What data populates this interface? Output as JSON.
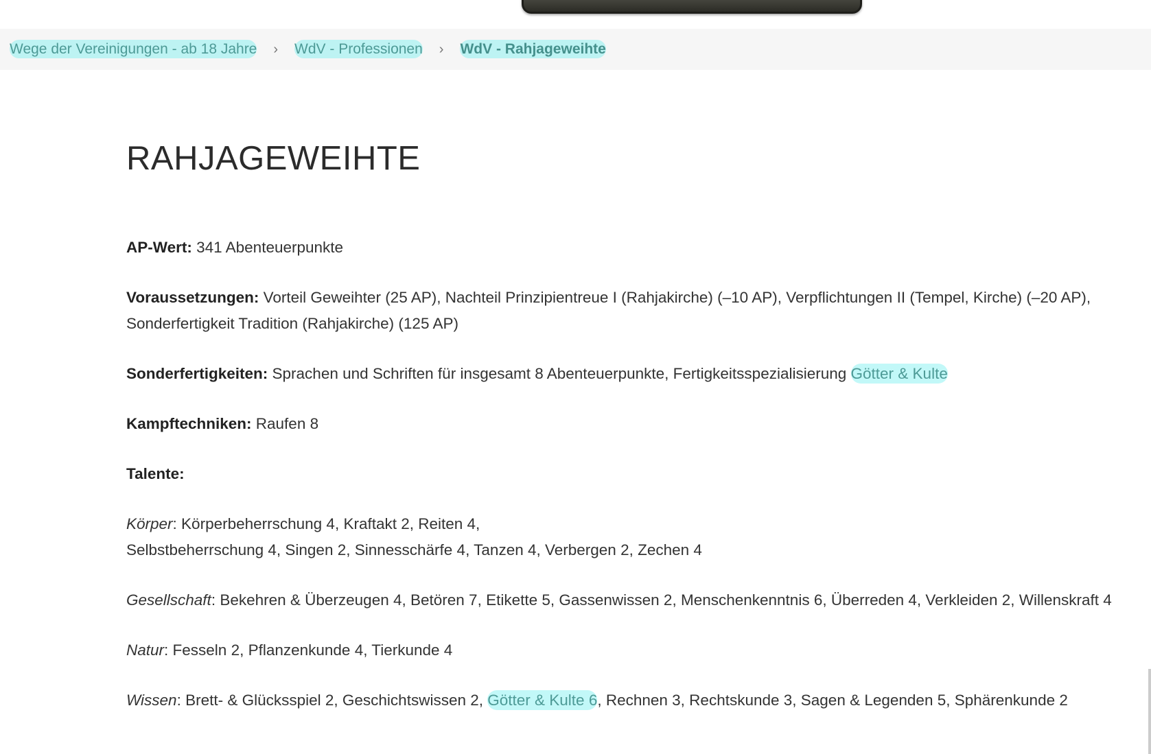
{
  "breadcrumb": {
    "items": [
      {
        "label": "Wege der Vereinigungen - ab 18 Jahre"
      },
      {
        "label": "WdV - Professionen"
      },
      {
        "label": "WdV - Rahjageweihte"
      }
    ],
    "separator": "›"
  },
  "article": {
    "title": "RAHJAGEWEIHTE",
    "ap": {
      "label": "AP-Wert:",
      "value": " 341 Abenteuerpunkte"
    },
    "voraussetzungen": {
      "label": "Voraussetzungen:",
      "value": " Vorteil Geweihter (25 AP), Nachteil Prinzipientreue I (Rahjakirche) (–10 AP), Verpflichtungen II (Tempel, Kirche) (–20 AP), Sonderfertigkeit Tradition (Rahjakirche) (125 AP)"
    },
    "sonderfertigkeiten": {
      "label": "Sonderfertigkeiten:",
      "value": " Sprachen und Schriften für insgesamt 8 Abenteuerpunkte, Fertigkeitsspezialisierung ",
      "link": "Götter & Kulte"
    },
    "kampftechniken": {
      "label": "Kampftechniken:",
      "value": " Raufen 8"
    },
    "talente": {
      "label": "Talente:"
    },
    "koerper": {
      "category": "Körper",
      "line1": ": Körperbeherrschung 4, Kraftakt 2, Reiten 4,",
      "line2": "Selbstbeherrschung 4, Singen 2, Sinnesschärfe 4, Tanzen 4, Verbergen 2, Zechen 4"
    },
    "gesellschaft": {
      "category": "Gesellschaft",
      "value": ": Bekehren & Überzeugen 4, Betören 7, Etikette 5, Gassenwissen 2, Menschenkenntnis 6, Überreden 4, Verkleiden 2, Willenskraft 4"
    },
    "natur": {
      "category": "Natur",
      "value": ": Fesseln 2, Pflanzenkunde 4, Tierkunde 4"
    },
    "wissen": {
      "category": "Wissen",
      "before": ": Brett- & Glücksspiel 2, Geschichtswissen 2, ",
      "link": "Götter & Kulte 6",
      "after": ", Rechnen 3, Rechtskunde 3, Sagen & Legenden 5, Sphärenkunde 2"
    }
  },
  "colors": {
    "link": "#4d9a96",
    "highlight": "#78f0f0",
    "text": "#333333",
    "breadcrumb_bg": "#f6f6f6"
  }
}
